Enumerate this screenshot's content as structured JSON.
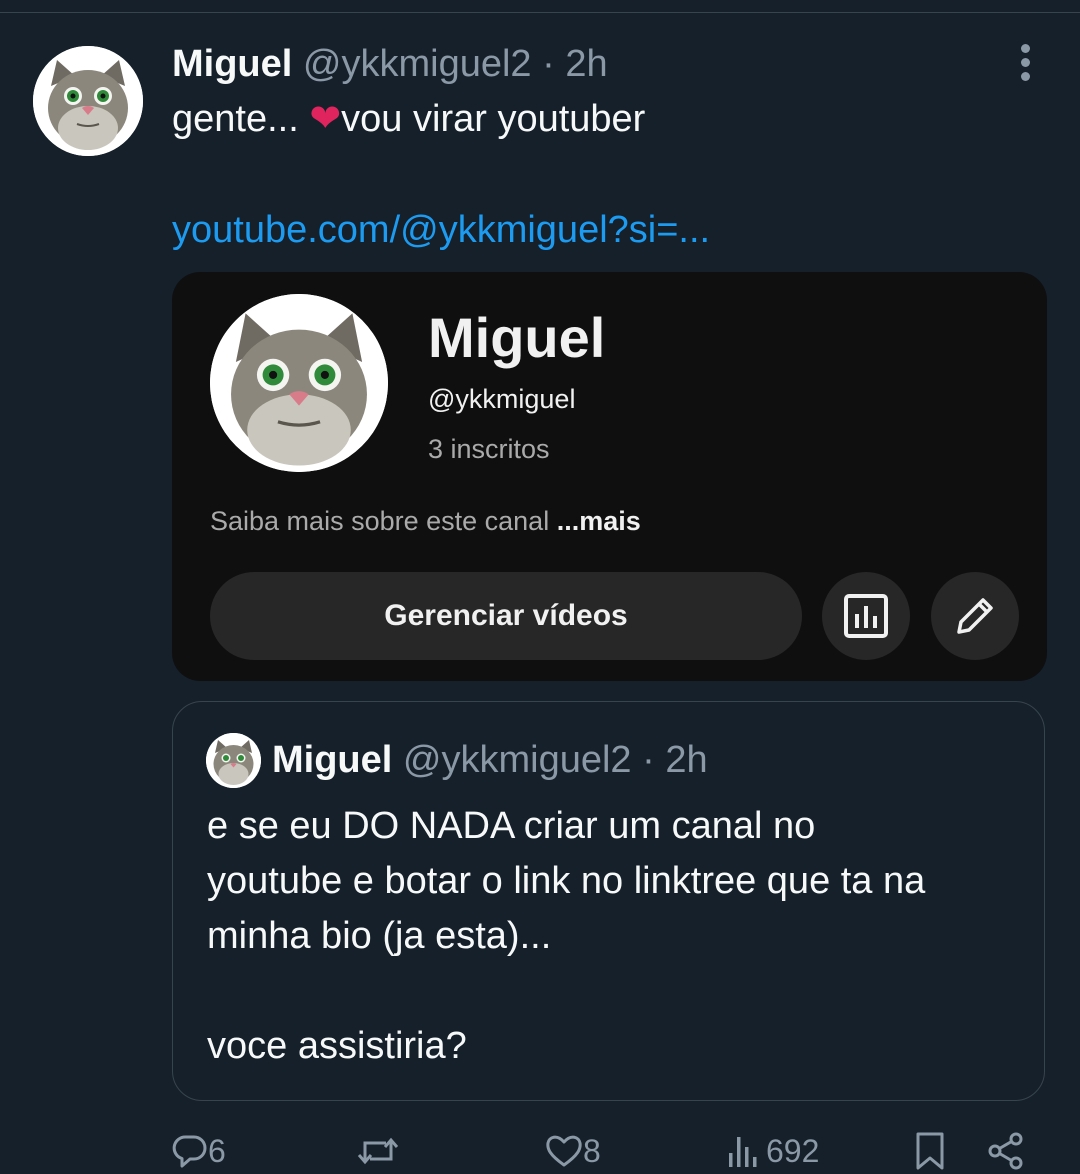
{
  "tweet": {
    "author_name": "Miguel",
    "handle": "@ykkmiguel2",
    "separator": "·",
    "time": "2h",
    "text_before_heart": "gente... ",
    "heart": "❤",
    "text_after_heart": "vou virar youtuber",
    "link": "youtube.com/@ykkmiguel?si=..."
  },
  "card": {
    "channel_name": "Miguel",
    "channel_handle": "@ykkmiguel",
    "subscribers": "3 inscritos",
    "description": "Saiba mais sobre este canal ",
    "more_label": "...mais",
    "manage_button": "Gerenciar vídeos"
  },
  "quote": {
    "author_name": "Miguel",
    "handle": "@ykkmiguel2",
    "separator": "·",
    "time": "2h",
    "text": "e se eu DO NADA criar um canal no\nyoutube e botar o link no linktree que ta na\nminha bio (ja esta)...\n\nvoce assistiria?"
  },
  "actions": {
    "replies": "6",
    "likes": "8",
    "views": "692"
  },
  "colors": {
    "background": "#15202b",
    "link": "#1d9bf0",
    "muted": "#8b98a5",
    "heart": "#e0245e",
    "card_bg": "#0f0f0f",
    "button_bg": "#272727"
  },
  "icons": [
    "more-icon",
    "chart-icon",
    "pencil-icon",
    "reply-icon",
    "retweet-icon",
    "like-icon",
    "views-icon",
    "bookmark-icon",
    "share-icon"
  ]
}
